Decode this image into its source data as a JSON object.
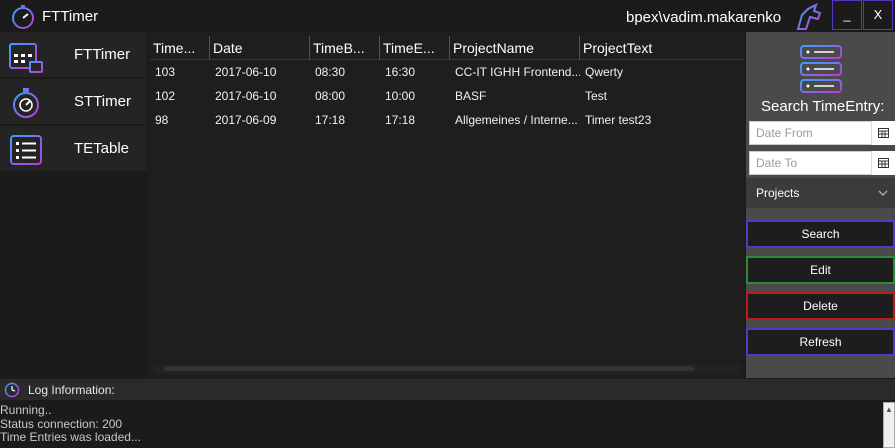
{
  "window": {
    "title": "FTTimer",
    "user": "bpex\\vadim.makarenko",
    "minimize_label": "_",
    "close_label": "X"
  },
  "nav": {
    "items": [
      {
        "label": "FTTimer",
        "icon": "calendar-icon"
      },
      {
        "label": "STTimer",
        "icon": "stopwatch-icon"
      },
      {
        "label": "TETable",
        "icon": "list-icon"
      }
    ]
  },
  "table": {
    "columns": [
      "TimeEntryId",
      "Date",
      "TimeBegin",
      "TimeEnd",
      "ProjectName",
      "ProjectText"
    ],
    "columns_display": [
      "Time...",
      "Date",
      "TimeB...",
      "TimeE...",
      "ProjectName",
      "ProjectText"
    ],
    "rows": [
      {
        "id": "103",
        "date": "2017-06-10",
        "begin": "08:30",
        "end": "16:30",
        "project": "CC-IT IGHH Frontend...",
        "text": "Qwerty"
      },
      {
        "id": "102",
        "date": "2017-06-10",
        "begin": "08:00",
        "end": "10:00",
        "project": "BASF",
        "text": "Test"
      },
      {
        "id": "98",
        "date": "2017-06-09",
        "begin": "17:18",
        "end": "17:18",
        "project": "Allgemeines / Interne...",
        "text": "Timer test23"
      }
    ]
  },
  "search": {
    "title": "Search TimeEntry:",
    "date_from_placeholder": "Date From",
    "date_to_placeholder": "Date To",
    "projects_label": "Projects"
  },
  "actions": {
    "search": "Search",
    "edit": "Edit",
    "delete": "Delete",
    "refresh": "Refresh"
  },
  "log": {
    "title": "Log Information:",
    "lines": [
      "Running..",
      "Status connection: 200",
      "Time Entries was loaded..."
    ]
  },
  "colors": {
    "accent_purple": "#5a35c0",
    "edit_green": "#2f8a3a",
    "delete_red": "#b81d1d",
    "icon_gradient_start": "#3aa0ff",
    "icon_gradient_end": "#c03ad8"
  }
}
